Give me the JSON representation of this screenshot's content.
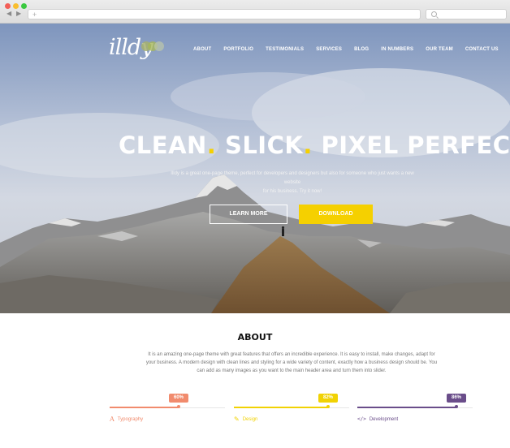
{
  "site": {
    "logo": "illdy",
    "nav": [
      "ABOUT",
      "PORTFOLIO",
      "TESTIMONIALS",
      "SERVICES",
      "BLOG",
      "IN NUMBERS",
      "OUR TEAM",
      "CONTACT US"
    ]
  },
  "hero": {
    "headline_1": "CLEAN",
    "headline_2": "SLICK",
    "headline_3": "PIXEL PERFECT",
    "separator": ".",
    "subtitle_1": "Illdy is a great one-page theme, perfect for developers and designers but also for someone who just wants a new website",
    "subtitle_2": "for his business. Try it now!",
    "learn_more": "LEARN MORE",
    "download": "DOWNLOAD"
  },
  "about": {
    "title": "ABOUT",
    "text": "It is an amazing one-page theme with great features that offers an incredible experience. It is easy to install, make changes, adapt for your business. A modern design with clean lines and styling for a wide variety of content, exactly how a business design should be. You can add as many images as you want to the main header area and turn them into slider.",
    "skills": [
      {
        "label": "Typography",
        "percent": 60,
        "badge": "60%",
        "icon": "typography-icon",
        "color": "#f18b6d"
      },
      {
        "label": "Design",
        "percent": 82,
        "badge": "82%",
        "icon": "pencil-icon",
        "color": "#f1d204"
      },
      {
        "label": "Development",
        "percent": 86,
        "badge": "86%",
        "icon": "code-icon",
        "color": "#6a4d8a"
      }
    ]
  },
  "colors": {
    "accent": "#f5d000"
  }
}
